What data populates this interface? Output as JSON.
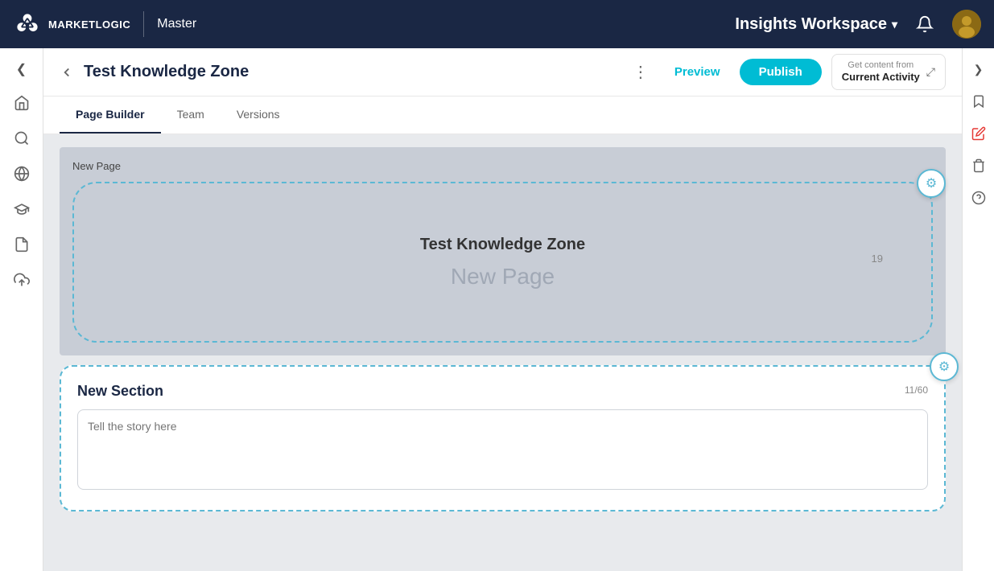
{
  "topNav": {
    "logoText": "MARKETLOGIC",
    "masterLabel": "Master",
    "workspaceTitle": "Insights Workspace",
    "bellIcon": "🔔",
    "avatarEmoji": "👩"
  },
  "header": {
    "backIcon": "←",
    "pageTitle": "Test Knowledge Zone",
    "dotsIcon": "⋮",
    "previewLabel": "Preview",
    "publishLabel": "Publish",
    "getContentLine1": "Get content from",
    "getContentLine2": "Current Activity",
    "expandIcon": "⤢"
  },
  "tabs": [
    {
      "label": "Page Builder",
      "active": true
    },
    {
      "label": "Team",
      "active": false
    },
    {
      "label": "Versions",
      "active": false
    }
  ],
  "pageBlock": {
    "pageLabel": "New Page",
    "innerTitle": "Test Knowledge Zone",
    "innerSubtitle": "New Page",
    "pageNumber": "19",
    "gearIcon": "⚙"
  },
  "sectionBlock": {
    "sectionTitle": "New Section",
    "counter": "11/60",
    "gearIcon": "⚙",
    "textareaPlaceholder": "Tell the story here"
  },
  "leftSidebar": {
    "toggleIcon": "❮",
    "icons": [
      "⌂",
      "🔍",
      "🌐",
      "🎓",
      "📋",
      "⬆"
    ]
  },
  "rightSidebar": {
    "toggleIcon": "❯",
    "icons": [
      "🔖",
      "📝",
      "🗑",
      "❓"
    ]
  }
}
